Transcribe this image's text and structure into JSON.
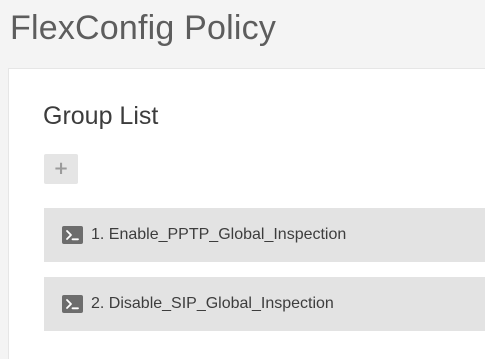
{
  "page": {
    "title": "FlexConfig Policy"
  },
  "group_list": {
    "heading": "Group List",
    "add_button_symbol": "+",
    "items": [
      {
        "label": "1. Enable_PPTP_Global_Inspection",
        "icon": "terminal-icon"
      },
      {
        "label": "2. Disable_SIP_Global_Inspection",
        "icon": "terminal-icon"
      }
    ]
  },
  "colors": {
    "page_background": "#f4f4f4",
    "panel_background": "#ffffff",
    "item_background": "#e3e3e3",
    "icon_background": "#6d6d6d",
    "title_text": "#5d5d5d"
  }
}
